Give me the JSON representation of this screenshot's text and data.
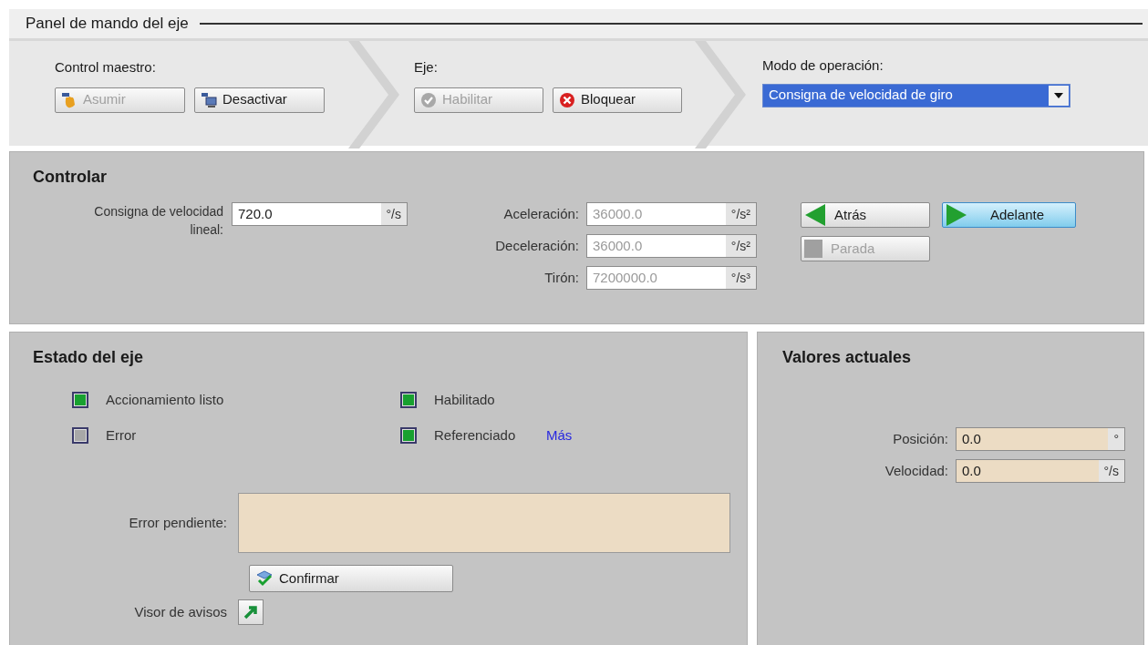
{
  "title": "Panel de mando del eje",
  "master_control": {
    "label": "Control maestro:",
    "buttons": [
      {
        "label": "Asumir",
        "disabled": true
      },
      {
        "label": "Desactivar",
        "disabled": false
      }
    ]
  },
  "axis": {
    "label": "Eje:",
    "buttons": [
      {
        "label": "Habilitar",
        "disabled": true
      },
      {
        "label": "Bloquear",
        "disabled": false
      }
    ]
  },
  "operation_mode": {
    "label": "Modo de operación:",
    "value": "Consigna de velocidad de giro"
  },
  "control": {
    "heading": "Controlar",
    "setpoint": {
      "label": "Consigna de velocidad lineal:",
      "value": "720.0",
      "unit": "°/s"
    },
    "params": [
      {
        "label": "Aceleración:",
        "value": "36000.0",
        "unit": "°/s²",
        "disabled": true
      },
      {
        "label": "Deceleración:",
        "value": "36000.0",
        "unit": "°/s²",
        "disabled": true
      },
      {
        "label": "Tirón:",
        "value": "7200000.0",
        "unit": "°/s³",
        "disabled": true
      }
    ],
    "buttons": [
      {
        "label": "Atrás",
        "disabled": false,
        "selected": false
      },
      {
        "label": "Adelante",
        "disabled": false,
        "selected": true
      },
      {
        "label": "Parada",
        "disabled": true,
        "selected": false
      }
    ]
  },
  "axis_status": {
    "heading": "Estado del eje",
    "indicators": [
      {
        "label": "Accionamiento listo",
        "on": true
      },
      {
        "label": "Habilitado",
        "on": true
      },
      {
        "label": "Error",
        "on": false
      },
      {
        "label": "Referenciado",
        "on": true
      }
    ],
    "more_link": "Más",
    "pending_error": {
      "label": "Error pendiente:"
    },
    "confirm_button": "Confirmar",
    "message_viewer": {
      "label": "Visor de avisos"
    }
  },
  "current_values": {
    "heading": "Valores actuales",
    "fields": [
      {
        "label": "Posición:",
        "value": "0.0",
        "unit": "°"
      },
      {
        "label": "Velocidad:",
        "value": "0.0",
        "unit": "°/s"
      }
    ]
  }
}
